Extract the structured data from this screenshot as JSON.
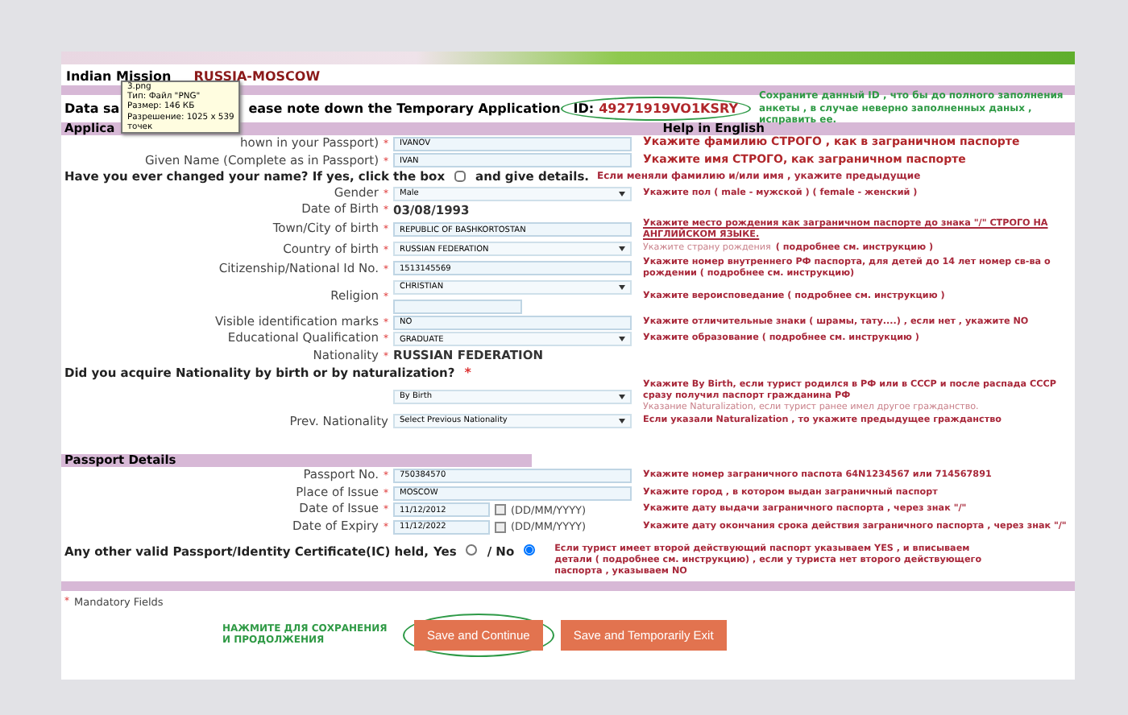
{
  "mission": {
    "label": "Indian Mission",
    "value": "RUSSIA-MOSCOW"
  },
  "notice": {
    "lead": "Data sa",
    "text": "ease note down the Temporary Application",
    "id_label": "ID:",
    "id": "49271919VO1KSRY",
    "help": "Сохраните данный ID , что бы до полного заполнения анкеты , в случае неверно заполненных даных , исправить ее."
  },
  "tooltip": [
    "3.png",
    "Тип: Файл \"PNG\"",
    "Размер: 146 КБ",
    "Разрешение: 1025 x 539",
    "точек"
  ],
  "application": {
    "title": "Applica",
    "help_title": "Help in English",
    "fields": [
      {
        "kind": "input",
        "label": "hown in your Passport)",
        "required": true,
        "value": "IVANOV",
        "help": [
          {
            "kind": "strong",
            "text": "Укажите фамилию СТРОГО , как в заграничном паспорте"
          }
        ]
      },
      {
        "kind": "input",
        "label": "Given Name (Complete as in Passport)",
        "required": true,
        "value": "IVAN",
        "help": [
          {
            "kind": "strong",
            "text": "Укажите имя СТРОГО, как заграничном паспорте"
          }
        ]
      },
      {
        "kind": "checkbox",
        "label": "Have you ever changed your name? If yes, click the box",
        "after": "and give details.",
        "checked": false,
        "help": [
          {
            "kind": "plain",
            "text": "Если меняли фамилию и/или имя , укажите предыдущие"
          }
        ]
      },
      {
        "kind": "select",
        "label": "Gender",
        "required": true,
        "value": "Male",
        "help": [
          {
            "kind": "plain",
            "text": "Укажите пол ( male - мужской ) ( female - женский )"
          }
        ]
      },
      {
        "kind": "static",
        "label": "Date of Birth",
        "required": true,
        "value": "03/08/1993"
      },
      {
        "kind": "input",
        "label": "Town/City of birth",
        "required": true,
        "value": "REPUBLIC OF BASHKORTOSTAN",
        "help": [
          {
            "kind": "link",
            "text": "Укажите место рождения как заграничном паспорте до знака \"/\" СТРОГО НА АНГЛИЙСКОМ ЯЗЫКЕ."
          }
        ]
      },
      {
        "kind": "select",
        "label": "Country of birth",
        "required": true,
        "value": "RUSSIAN FEDERATION",
        "help": [
          {
            "kind": "muted",
            "text": "Укажите страну рождения"
          },
          {
            "kind": "plain",
            "text": "( подробнее см. инструкцию )"
          }
        ]
      },
      {
        "kind": "input",
        "label": "Citizenship/National Id No.",
        "required": true,
        "value": "1513145569",
        "help": [
          {
            "kind": "plain",
            "text": "Укажите номер внутреннего РФ паспорта, для детей до 14 лет номер св-ва о рождении ( подробнее см. инструкцию)"
          }
        ]
      },
      {
        "kind": "select-extra",
        "label": "Religion",
        "required": true,
        "value": "CHRISTIAN",
        "help": [
          {
            "kind": "plain",
            "text": "Укажите вероисповедание ( подробнее см. инструкцию )"
          }
        ]
      },
      {
        "kind": "input",
        "label": "Visible identification marks",
        "required": true,
        "value": "NO",
        "help": [
          {
            "kind": "plain",
            "text": "Укажите отличительные знаки ( шрамы, тату....) , если нет , укажите NO"
          }
        ]
      },
      {
        "kind": "select",
        "label": "Educational Qualification",
        "required": true,
        "value": "GRADUATE",
        "help": [
          {
            "kind": "plain",
            "text": "Укажите образование ( подробнее см. инструкцию )"
          }
        ]
      },
      {
        "kind": "static",
        "label": "Nationality",
        "required": true,
        "value": "RUSSIAN FEDERATION"
      },
      {
        "kind": "question",
        "label": "Did you acquire Nationality by birth or by naturalization?",
        "required": true
      },
      {
        "kind": "select",
        "value": "By Birth",
        "help": [
          {
            "kind": "plain",
            "text": "Укажите By Birth, если турист родился в РФ или в СССР и после распада СССР сразу получил паспорт гражданина РФ"
          },
          {
            "kind": "muted",
            "text": "Указание Naturalization, если турист ранее имел другое гражданство."
          }
        ]
      },
      {
        "kind": "select",
        "label": "Prev. Nationality",
        "value": "Select Previous Nationality",
        "help": [
          {
            "kind": "plain",
            "text": "Если указали Naturalization , то укажите предыдущее гражданство"
          }
        ]
      }
    ]
  },
  "passport": {
    "title": "Passport Details",
    "fields": [
      {
        "kind": "input",
        "label": "Passport No.",
        "required": true,
        "value": "750384570",
        "help": [
          {
            "kind": "plain",
            "text": "Укажите номер заграничного паспота 64N1234567 или 714567891"
          }
        ]
      },
      {
        "kind": "input",
        "label": "Place of Issue",
        "required": true,
        "value": "MOSCOW",
        "help": [
          {
            "kind": "plain",
            "text": "Укажите город , в котором выдан заграничный паспорт"
          }
        ]
      },
      {
        "kind": "date",
        "label": "Date of Issue",
        "required": true,
        "value": "11/12/2012",
        "hint": "(DD/MM/YYYY)",
        "help": [
          {
            "kind": "plain",
            "text": "Укажите дату выдачи заграничного паспорта , через знак \"/\""
          }
        ]
      },
      {
        "kind": "date",
        "label": "Date of Expiry",
        "required": true,
        "value": "11/12/2022",
        "hint": "(DD/MM/YYYY)",
        "help": [
          {
            "kind": "plain",
            "text": "Укажите дату окончания срока действия заграничного паспорта , через знак \"/\""
          }
        ]
      },
      {
        "kind": "radio",
        "label": "Any other valid Passport/Identity Certificate(IC) held,",
        "options": [
          {
            "label": "Yes",
            "selected": false
          },
          {
            "label": "/ No",
            "selected": true
          }
        ],
        "help": [
          {
            "kind": "plain",
            "text": "Если турист имеет второй действующий паспорт указываем YES , и вписываем детали ( подробнее см. инструкцию) , если у туриста нет второго действующего паспорта , указываем NO"
          }
        ]
      }
    ]
  },
  "footer": {
    "mandatory_mark": "*",
    "mandatory": "Mandatory Fields",
    "note": "НАЖМИТЕ ДЛЯ СОХРАНЕНИЯ И ПРОДОЛЖЕНИЯ",
    "buttons": [
      {
        "label": "Save and Continue",
        "circled": true
      },
      {
        "label": "Save and Temporarily Exit",
        "circled": false
      }
    ]
  }
}
